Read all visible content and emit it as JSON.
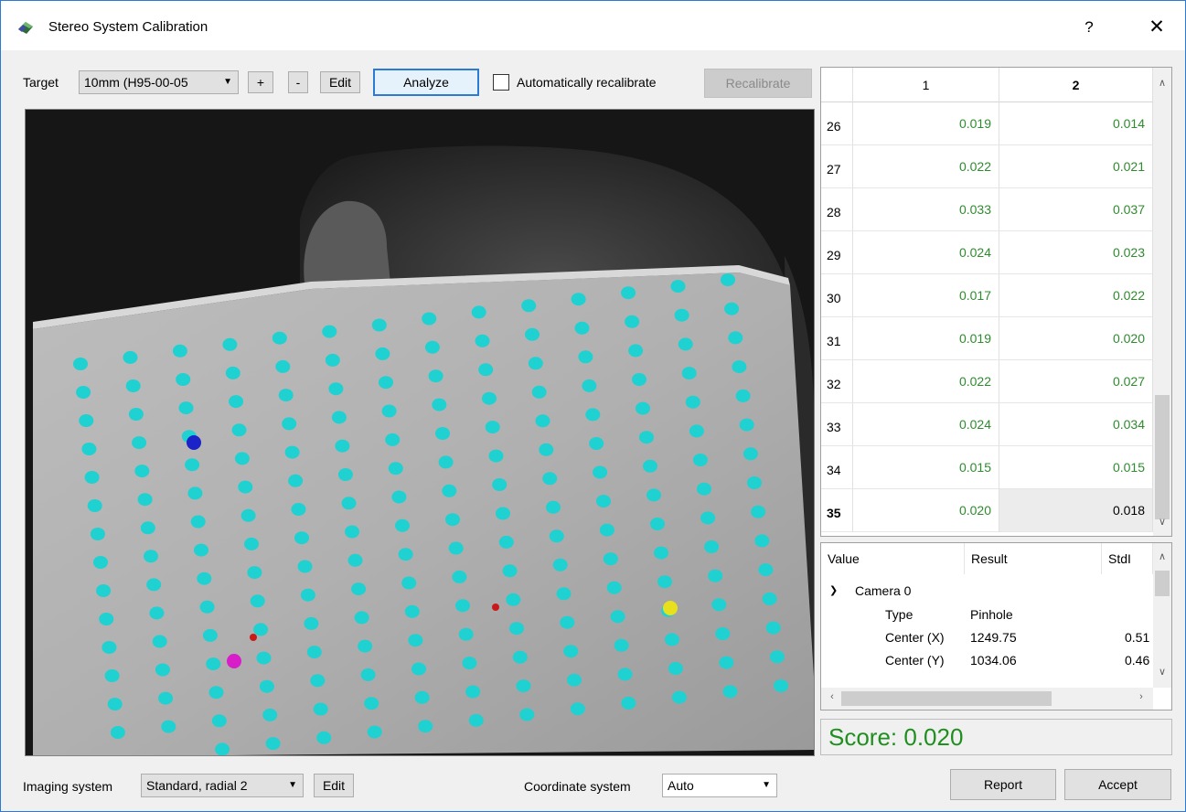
{
  "window": {
    "title": "Stereo System Calibration",
    "help": "?",
    "close": "✕"
  },
  "toolbar": {
    "target_label": "Target",
    "target_value": "10mm (H95-00-05",
    "add": "+",
    "remove": "-",
    "edit": "Edit",
    "analyze": "Analyze",
    "auto_recalibrate": "Automatically recalibrate",
    "recalibrate": "Recalibrate"
  },
  "table": {
    "columns": [
      "1",
      "2"
    ],
    "rows": [
      {
        "num": "26",
        "c1": "0.019",
        "c2": "0.014"
      },
      {
        "num": "27",
        "c1": "0.022",
        "c2": "0.021"
      },
      {
        "num": "28",
        "c1": "0.033",
        "c2": "0.037"
      },
      {
        "num": "29",
        "c1": "0.024",
        "c2": "0.023"
      },
      {
        "num": "30",
        "c1": "0.017",
        "c2": "0.022"
      },
      {
        "num": "31",
        "c1": "0.019",
        "c2": "0.020"
      },
      {
        "num": "32",
        "c1": "0.022",
        "c2": "0.027"
      },
      {
        "num": "33",
        "c1": "0.024",
        "c2": "0.034"
      },
      {
        "num": "34",
        "c1": "0.015",
        "c2": "0.015"
      },
      {
        "num": "35",
        "c1": "0.020",
        "c2": "0.018"
      }
    ],
    "value_color": "#2e8b2e"
  },
  "tree": {
    "columns": [
      "Value",
      "Result",
      "StdI"
    ],
    "camera": "Camera 0",
    "rows": [
      {
        "name": "Type",
        "result": "Pinhole",
        "std": ""
      },
      {
        "name": "Center (X)",
        "result": "1249.75",
        "std": "0.51"
      },
      {
        "name": "Center (Y)",
        "result": "1034.06",
        "std": "0.46"
      }
    ]
  },
  "score": "Score: 0.020",
  "bottom": {
    "imaging_label": "Imaging system",
    "imaging_value": "Standard, radial 2",
    "imaging_edit": "Edit",
    "coord_label": "Coordinate system",
    "coord_value": "Auto",
    "report": "Report",
    "accept": "Accept"
  },
  "colors": {
    "dot": "#1fd1d1",
    "marker_blue": "#1a22c8",
    "marker_magenta": "#d81ec8",
    "marker_yellow": "#e8e01a",
    "marker_red": "#c81a1a",
    "accent": "#2b7bd6"
  }
}
